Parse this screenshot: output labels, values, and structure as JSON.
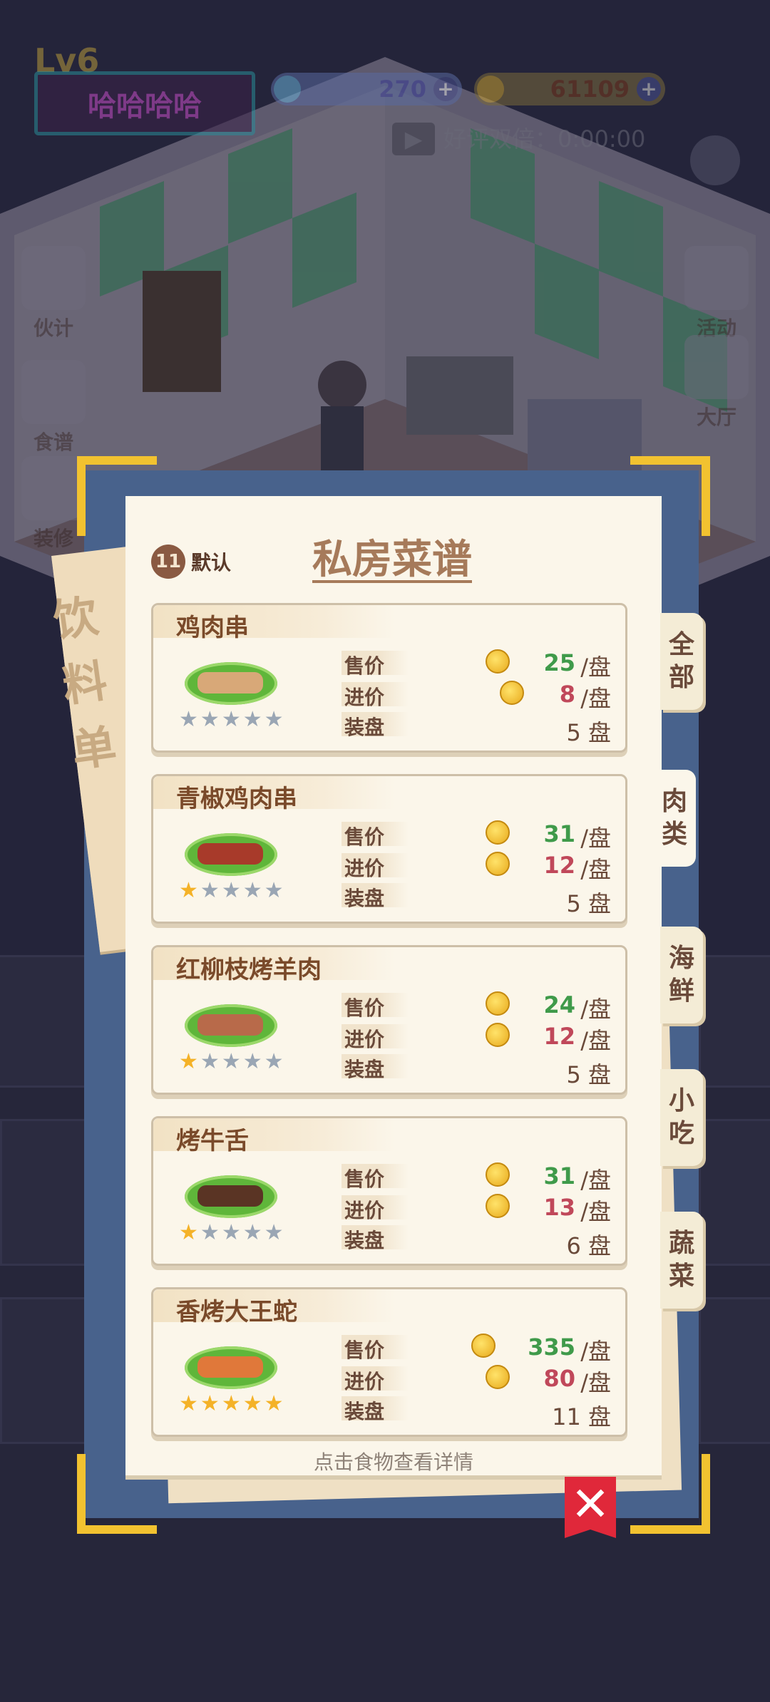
{
  "hud": {
    "level": "Lv6",
    "player_name": "哈哈哈哈",
    "gems": "270",
    "coins": "61109",
    "bonus_label": "好评双倍：0:00:00"
  },
  "side_buttons": {
    "left": [
      "伙计",
      "食谱",
      "装修"
    ],
    "right": [
      "活动",
      "大厅"
    ]
  },
  "dialog": {
    "title": "私房菜谱",
    "default_label": "默认",
    "default_icon_text": "11",
    "drink_sheet_label": "饮料单",
    "hint": "点击食物查看详情",
    "close_symbol": "✕",
    "tabs": [
      {
        "label": "全部",
        "active": false
      },
      {
        "label": "肉类",
        "active": true
      },
      {
        "label": "海鲜",
        "active": false
      },
      {
        "label": "小吃",
        "active": false
      },
      {
        "label": "蔬菜",
        "active": false
      }
    ],
    "row_labels": {
      "price": "售价",
      "cost": "进价",
      "plates": "装盘"
    },
    "unit": "/盘",
    "dishes": [
      {
        "name": "鸡肉串",
        "price": "25",
        "cost": "8",
        "plates": "5 盘",
        "stars": 0,
        "food_color": "#d8a878"
      },
      {
        "name": "青椒鸡肉串",
        "price": "31",
        "cost": "12",
        "plates": "5 盘",
        "stars": 1,
        "food_color": "#a83a2a"
      },
      {
        "name": "红柳枝烤羊肉",
        "price": "24",
        "cost": "12",
        "plates": "5 盘",
        "stars": 1,
        "food_color": "#b86a4a"
      },
      {
        "name": "烤牛舌",
        "price": "31",
        "cost": "13",
        "plates": "6 盘",
        "stars": 1,
        "food_color": "#5a3424"
      },
      {
        "name": "香烤大王蛇",
        "price": "335",
        "cost": "80",
        "plates": "11 盘",
        "stars": 5,
        "food_color": "#e0783a"
      }
    ]
  },
  "colors": {
    "frame": "#48628c",
    "accent_gold": "#f2c230",
    "price_green": "#3f9a4a",
    "cost_red": "#c0485a"
  }
}
